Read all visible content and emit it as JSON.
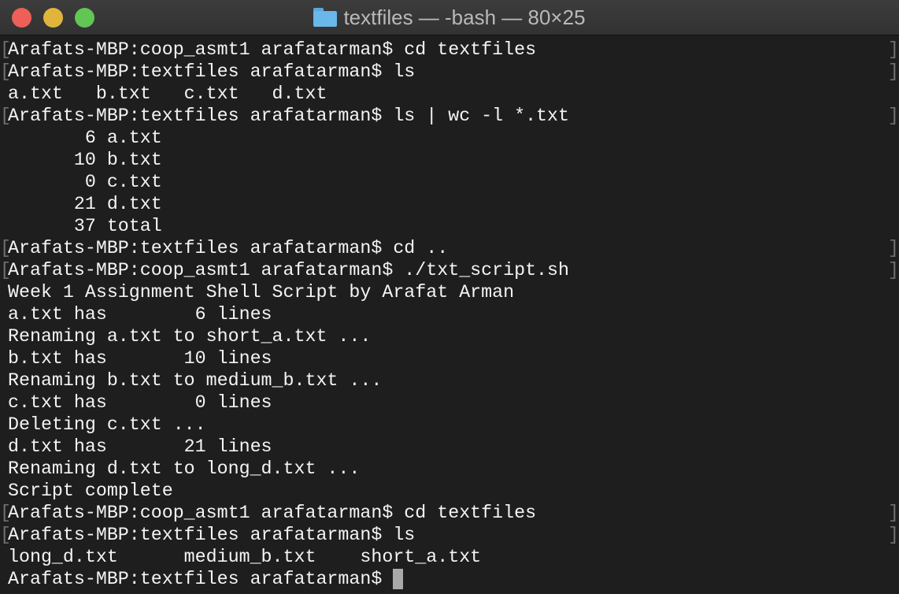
{
  "window": {
    "title": "textfiles — -bash — 80×25",
    "folder_icon": "folder-icon",
    "traffic_lights": {
      "close": "#ed5f57",
      "minimize": "#e1b53c",
      "zoom": "#62c554"
    }
  },
  "terminal": {
    "text_color": "#f4f4f4",
    "background": "#1e1e1e",
    "lines": [
      {
        "text": "Arafats-MBP:coop_asmt1 arafatarman$ cd textfiles",
        "prompt": true
      },
      {
        "text": "Arafats-MBP:textfiles arafatarman$ ls",
        "prompt": true
      },
      {
        "text": "a.txt   b.txt   c.txt   d.txt",
        "prompt": false
      },
      {
        "text": "Arafats-MBP:textfiles arafatarman$ ls | wc -l *.txt",
        "prompt": true
      },
      {
        "text": "       6 a.txt",
        "prompt": false
      },
      {
        "text": "      10 b.txt",
        "prompt": false
      },
      {
        "text": "       0 c.txt",
        "prompt": false
      },
      {
        "text": "      21 d.txt",
        "prompt": false
      },
      {
        "text": "      37 total",
        "prompt": false
      },
      {
        "text": "Arafats-MBP:textfiles arafatarman$ cd ..",
        "prompt": true
      },
      {
        "text": "Arafats-MBP:coop_asmt1 arafatarman$ ./txt_script.sh",
        "prompt": true
      },
      {
        "text": "Week 1 Assignment Shell Script by Arafat Arman",
        "prompt": false
      },
      {
        "text": "a.txt has        6 lines",
        "prompt": false
      },
      {
        "text": "Renaming a.txt to short_a.txt ...",
        "prompt": false
      },
      {
        "text": "b.txt has       10 lines",
        "prompt": false
      },
      {
        "text": "Renaming b.txt to medium_b.txt ...",
        "prompt": false
      },
      {
        "text": "c.txt has        0 lines",
        "prompt": false
      },
      {
        "text": "Deleting c.txt ...",
        "prompt": false
      },
      {
        "text": "d.txt has       21 lines",
        "prompt": false
      },
      {
        "text": "Renaming d.txt to long_d.txt ...",
        "prompt": false
      },
      {
        "text": "Script complete",
        "prompt": false
      },
      {
        "text": "Arafats-MBP:coop_asmt1 arafatarman$ cd textfiles",
        "prompt": true
      },
      {
        "text": "Arafats-MBP:textfiles arafatarman$ ls",
        "prompt": true
      },
      {
        "text": "long_d.txt      medium_b.txt    short_a.txt",
        "prompt": false
      },
      {
        "text": "Arafats-MBP:textfiles arafatarman$ ",
        "prompt": false,
        "cursor": true
      }
    ]
  }
}
